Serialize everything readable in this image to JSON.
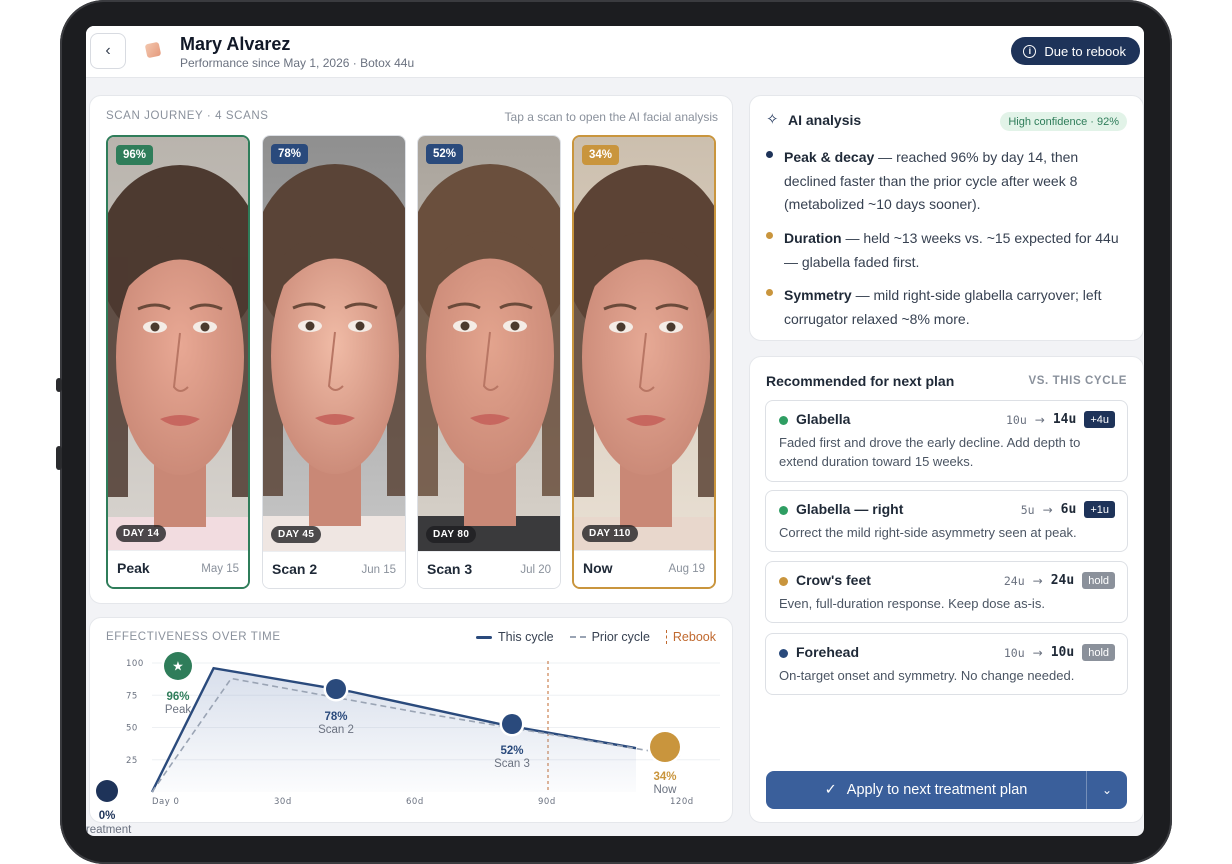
{
  "header": {
    "patient_name": "Mary Alvarez",
    "subtitle": "Performance since May 1, 2026 · Botox 44u",
    "rebook_label": "Due to rebook"
  },
  "journey": {
    "caption": "SCAN JOURNEY · 4 SCANS",
    "hint": "Tap a scan to open the AI facial analysis",
    "scans": [
      {
        "pct": "96%",
        "day": "DAY 14",
        "label": "Peak",
        "date": "May 15",
        "badge_color": "#2f7d5a"
      },
      {
        "pct": "78%",
        "day": "DAY 45",
        "label": "Scan 2",
        "date": "Jun 15",
        "badge_color": "#2a4a7c"
      },
      {
        "pct": "52%",
        "day": "DAY 80",
        "label": "Scan 3",
        "date": "Jul 20",
        "badge_color": "#2a4a7c"
      },
      {
        "pct": "34%",
        "day": "DAY 110",
        "label": "Now",
        "date": "Aug 19",
        "badge_color": "#c9953d"
      }
    ]
  },
  "effectiveness": {
    "caption": "EFFECTIVENESS OVER TIME",
    "legend_this": "This cycle",
    "legend_prior": "Prior cycle",
    "legend_rebook": "Rebook"
  },
  "chart_data": {
    "type": "line",
    "title": "EFFECTIVENESS OVER TIME",
    "xlabel": "",
    "ylabel": "",
    "x_ticks": [
      "Day 0",
      "30d",
      "60d",
      "90d",
      "120d"
    ],
    "y_ticks": [
      "100",
      "75",
      "50",
      "25"
    ],
    "xlim": [
      0,
      120
    ],
    "ylim": [
      0,
      100
    ],
    "grid": true,
    "legend": "top-right",
    "rebook_day": 90,
    "series": [
      {
        "name": "This cycle",
        "x": [
          0,
          14,
          45,
          80,
          110
        ],
        "y": [
          0,
          96,
          78,
          52,
          34
        ],
        "color": "#2a4a7c"
      },
      {
        "name": "Prior cycle",
        "x": [
          0,
          18,
          60,
          120
        ],
        "y": [
          0,
          88,
          62,
          28
        ],
        "color": "#9aa4b4"
      }
    ],
    "points": [
      {
        "x": 0,
        "y": 0,
        "value": "0%",
        "label": "treatment",
        "color": "#1e3359"
      },
      {
        "x": 14,
        "y": 96,
        "value": "96%",
        "label": "Peak",
        "color": "#2f7d5a"
      },
      {
        "x": 45,
        "y": 78,
        "value": "78%",
        "label": "Scan 2",
        "color": "#2a4a7c"
      },
      {
        "x": 80,
        "y": 52,
        "value": "52%",
        "label": "Scan 3",
        "color": "#2a4a7c"
      },
      {
        "x": 110,
        "y": 34,
        "value": "34%",
        "label": "Now",
        "color": "#c9953d"
      }
    ]
  },
  "ai": {
    "title": "AI analysis",
    "confidence": "High confidence · 92%",
    "bullets": [
      {
        "head": "Peak & decay",
        "body": " — reached 96% by day 14, then declined faster than the prior cycle after week 8 (metabolized ~10 days sooner).",
        "color": "#1e3359"
      },
      {
        "head": "Duration",
        "body": " — held ~13 weeks vs. ~15 expected for 44u — glabella faded first.",
        "color": "#c9953d"
      },
      {
        "head": "Symmetry",
        "body": " — mild right-side glabella carryover; left corrugator relaxed ~8% more.",
        "color": "#c9953d"
      }
    ]
  },
  "recommend": {
    "title": "Recommended for next plan",
    "vs_label": "VS. THIS CYCLE",
    "items": [
      {
        "name": "Glabella",
        "from": "10u",
        "to": "14u",
        "tag": "+4u",
        "tag_kind": "plus",
        "color": "#2f9e63",
        "desc": "Faded first and drove the early decline. Add depth to extend duration toward 15 weeks."
      },
      {
        "name": "Glabella — right",
        "from": "5u",
        "to": "6u",
        "tag": "+1u",
        "tag_kind": "plus",
        "color": "#2f9e63",
        "desc": "Correct the mild right-side asymmetry seen at peak."
      },
      {
        "name": "Crow's feet",
        "from": "24u",
        "to": "24u",
        "tag": "hold",
        "tag_kind": "hold",
        "color": "#c9953d",
        "desc": "Even, full-duration response. Keep dose as-is."
      },
      {
        "name": "Forehead",
        "from": "10u",
        "to": "10u",
        "tag": "hold",
        "tag_kind": "hold",
        "color": "#2a4a7c",
        "desc": "On-target onset and symmetry. No change needed."
      }
    ],
    "apply_label": "Apply to next treatment plan"
  }
}
